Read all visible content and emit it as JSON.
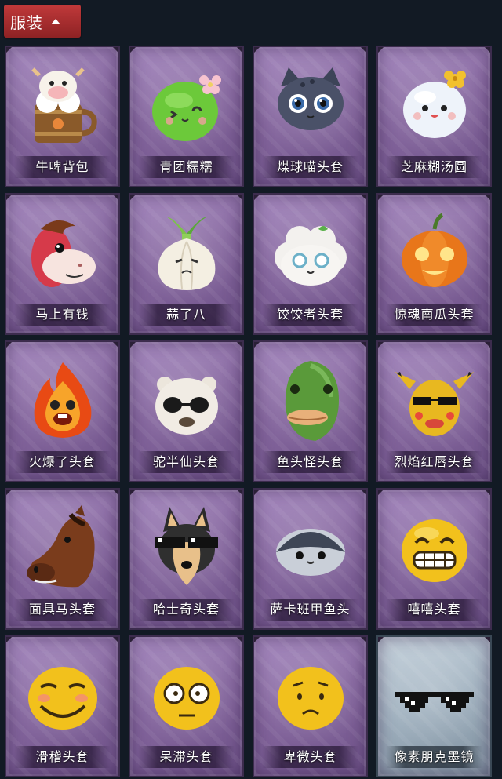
{
  "header": {
    "title": "服装",
    "chevron_icon": "chevron-up-icon"
  },
  "items": [
    {
      "label": "牛啤背包",
      "icon": "beer-barrel-cow-icon"
    },
    {
      "label": "青团糯糯",
      "icon": "green-rice-ball-icon"
    },
    {
      "label": "煤球喵头套",
      "icon": "black-cat-head-icon"
    },
    {
      "label": "芝麻糊汤圆",
      "icon": "white-dumpling-icon"
    },
    {
      "label": "马上有钱",
      "icon": "red-horse-icon"
    },
    {
      "label": "蒜了八",
      "icon": "garlic-icon"
    },
    {
      "label": "饺饺者头套",
      "icon": "cloud-dumpling-icon"
    },
    {
      "label": "惊魂南瓜头套",
      "icon": "pumpkin-icon"
    },
    {
      "label": "火爆了头套",
      "icon": "fireball-icon"
    },
    {
      "label": "驼半仙头套",
      "icon": "alpaca-sunglasses-icon"
    },
    {
      "label": "鱼头怪头套",
      "icon": "fish-head-icon"
    },
    {
      "label": "烈焰红唇头套",
      "icon": "yellow-creature-sunglasses-icon"
    },
    {
      "label": "面具马头套",
      "icon": "horse-mask-icon"
    },
    {
      "label": "哈士奇头套",
      "icon": "husky-sunglasses-icon"
    },
    {
      "label": "萨卡班甲鱼头",
      "icon": "sacabambaspis-icon"
    },
    {
      "label": "嘻嘻头套",
      "icon": "grin-emoji-icon"
    },
    {
      "label": "滑稽头套",
      "icon": "smirk-emoji-icon"
    },
    {
      "label": "呆滞头套",
      "icon": "dazed-emoji-icon"
    },
    {
      "label": "卑微头套",
      "icon": "humble-emoji-icon"
    },
    {
      "label": "像素朋克墨镜",
      "icon": "pixel-sunglasses-icon"
    }
  ]
}
